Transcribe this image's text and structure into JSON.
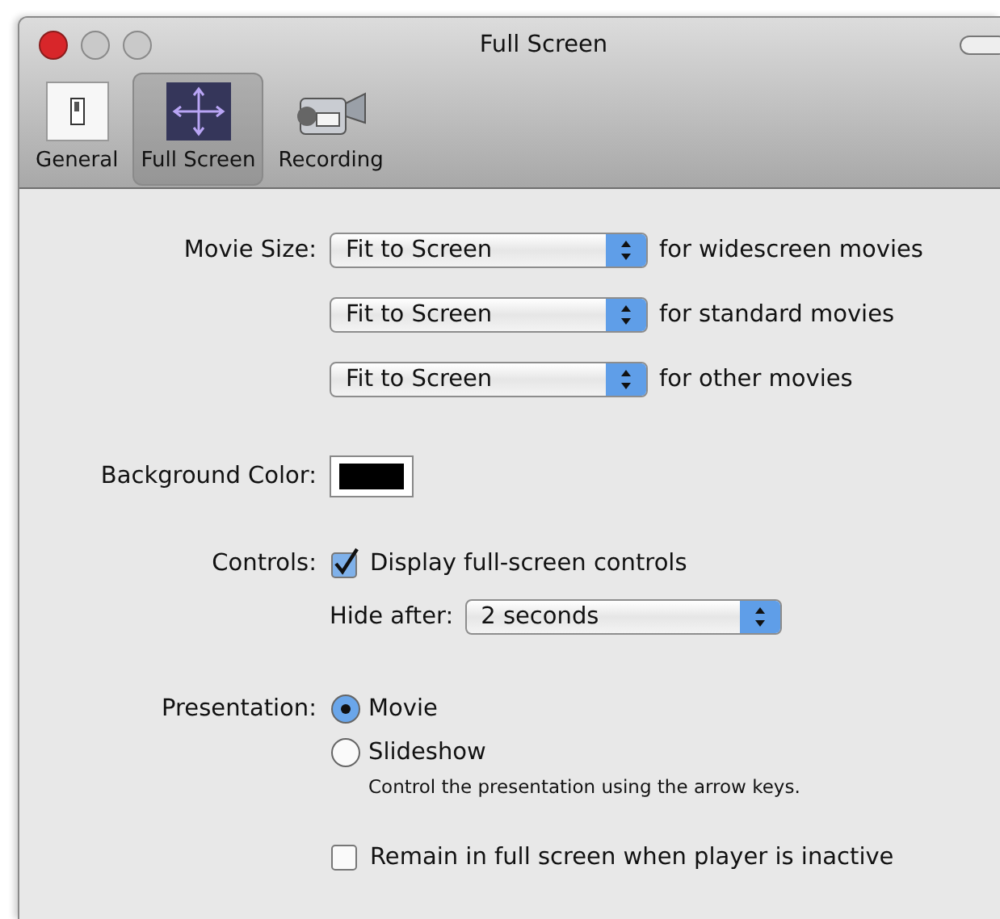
{
  "window": {
    "title": "Full Screen"
  },
  "toolbar": {
    "tabs": [
      {
        "label": "General",
        "selected": false,
        "kind": "switch"
      },
      {
        "label": "Full Screen",
        "selected": true,
        "kind": "arrows"
      },
      {
        "label": "Recording",
        "selected": false,
        "kind": "camera"
      }
    ]
  },
  "movie_size": {
    "label": "Movie Size:",
    "rows": [
      {
        "value": "Fit to Screen",
        "note": "for widescreen movies"
      },
      {
        "value": "Fit to Screen",
        "note": "for standard movies"
      },
      {
        "value": "Fit to Screen",
        "note": "for other movies"
      }
    ]
  },
  "background_color": {
    "label": "Background Color:",
    "color": "#000000"
  },
  "controls": {
    "label": "Controls:",
    "checkbox": {
      "label": "Display full-screen controls",
      "checked": true
    },
    "hide_after": {
      "label": "Hide after:",
      "value": "2 seconds"
    }
  },
  "presentation": {
    "label": "Presentation:",
    "options": [
      {
        "label": "Movie",
        "selected": true
      },
      {
        "label": "Slideshow",
        "selected": false
      }
    ],
    "hint": "Control the presentation using the arrow keys."
  },
  "remain": {
    "label": "Remain in full screen when player is inactive",
    "checked": false
  }
}
